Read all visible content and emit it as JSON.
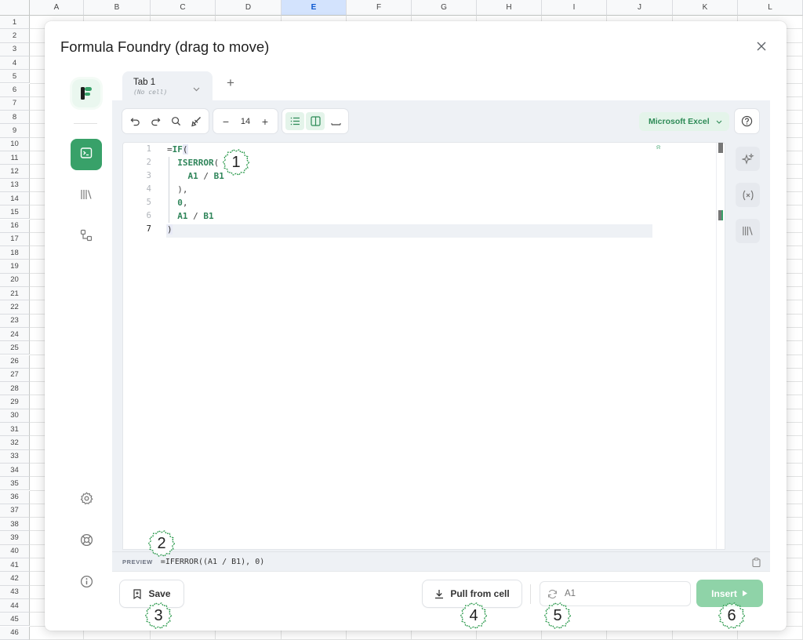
{
  "sheet": {
    "columns": [
      "A",
      "B",
      "C",
      "D",
      "E",
      "F",
      "G",
      "H",
      "I",
      "J",
      "K",
      "L"
    ],
    "active_column": "E",
    "rows": [
      "1",
      "2",
      "3",
      "4",
      "5",
      "6",
      "7",
      "8",
      "9",
      "10",
      "11",
      "12",
      "13",
      "14",
      "15",
      "16",
      "17",
      "18",
      "19",
      "20",
      "21",
      "22",
      "23",
      "24",
      "25",
      "26",
      "27",
      "28",
      "29",
      "30",
      "31",
      "32",
      "33",
      "34",
      "35",
      "36",
      "37",
      "38",
      "39",
      "40",
      "41",
      "42",
      "43",
      "44",
      "45",
      "46"
    ]
  },
  "dialog": {
    "title": "Formula Foundry (drag to move)",
    "close_icon": "close-icon"
  },
  "rail": {
    "logo_icon": "app-logo",
    "items": [
      {
        "name": "editor",
        "icon": "terminal-icon",
        "active": true
      },
      {
        "name": "library",
        "icon": "library-icon",
        "active": false
      },
      {
        "name": "flow",
        "icon": "nodes-icon",
        "active": false
      }
    ],
    "bottom": [
      {
        "name": "settings",
        "icon": "gear-icon"
      },
      {
        "name": "support",
        "icon": "lifebuoy-icon"
      },
      {
        "name": "info",
        "icon": "info-icon"
      }
    ]
  },
  "tabs": [
    {
      "label": "Tab 1",
      "subtitle": "(No cell)"
    }
  ],
  "add_tab": "+",
  "toolbar": {
    "font_size": "14",
    "minus": "−",
    "plus": "+",
    "language": "Microsoft Excel"
  },
  "editor": {
    "line_numbers": [
      "1",
      "2",
      "3",
      "4",
      "5",
      "6",
      "7"
    ],
    "current_line": "7"
  },
  "preview": {
    "label": "PREVIEW",
    "text": "=IFERROR((A1 / B1), 0)"
  },
  "footer": {
    "save_label": "Save",
    "pull_label": "Pull from cell",
    "range_placeholder": "A1",
    "insert_label": "Insert"
  },
  "callouts": [
    "1",
    "2",
    "3",
    "4",
    "5",
    "6"
  ],
  "colors": {
    "accent": "#38a169",
    "accent_light": "#e4f4ea",
    "insert_bg": "#8fd3a8",
    "panel_bg": "#eef1f5"
  }
}
